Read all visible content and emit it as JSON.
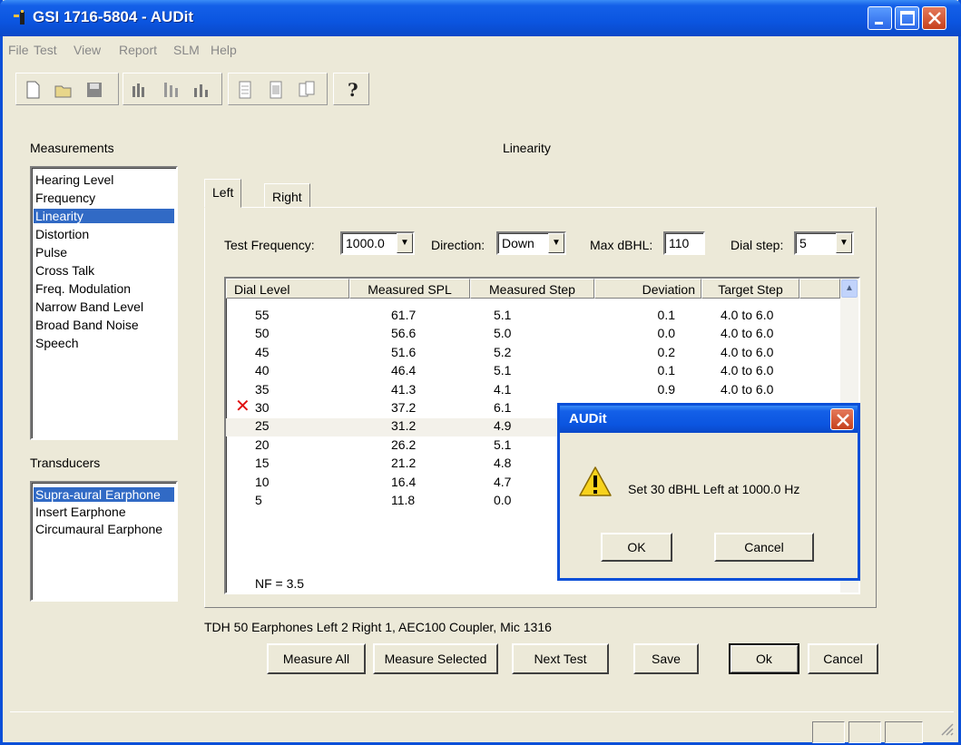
{
  "window": {
    "title": "GSI 1716-5804 - AUDit"
  },
  "menu": [
    "File",
    "Test",
    "View",
    "Report",
    "SLM",
    "Help"
  ],
  "toolbar_icons": [
    "new-icon",
    "open-icon",
    "save-icon",
    "audiogram-icon",
    "bars-icon",
    "bars-alt-icon",
    "report-icon",
    "report-list-icon",
    "report-compare-icon",
    "help-icon"
  ],
  "measurements": {
    "label": "Measurements",
    "items": [
      "Hearing Level",
      "Frequency",
      "Linearity",
      "Distortion",
      "Pulse",
      "Cross Talk",
      "Freq. Modulation",
      "Narrow Band Level",
      "Broad Band Noise",
      "Speech"
    ],
    "selected": "Linearity"
  },
  "transducers": {
    "label": "Transducers",
    "items": [
      "Supra-aural Earphone",
      "Insert Earphone",
      "Circumaural Earphone"
    ],
    "selected": "Supra-aural Earphone"
  },
  "section_title": "Linearity",
  "tabs": [
    "Left",
    "Right"
  ],
  "controls": {
    "test_frequency_label": "Test Frequency:",
    "test_frequency_value": "1000.0",
    "direction_label": "Direction:",
    "direction_value": "Down",
    "max_dbhl_label": "Max dBHL:",
    "max_dbhl_value": "110",
    "dial_step_label": "Dial step:",
    "dial_step_value": "5"
  },
  "table": {
    "headers": [
      "Dial Level",
      "Measured SPL",
      "Measured Step",
      "Deviation",
      "Target Step"
    ],
    "rows": [
      [
        "55",
        "61.7",
        "5.1",
        "0.1",
        "4.0 to 6.0"
      ],
      [
        "50",
        "56.6",
        "5.0",
        "0.0",
        "4.0 to 6.0"
      ],
      [
        "45",
        "51.6",
        "5.2",
        "0.2",
        "4.0 to 6.0"
      ],
      [
        "40",
        "46.4",
        "5.1",
        "0.1",
        "4.0 to 6.0"
      ],
      [
        "35",
        "41.3",
        "4.1",
        "0.9",
        "4.0 to 6.0"
      ],
      [
        "30",
        "37.2",
        "6.1",
        "",
        ""
      ],
      [
        "25",
        "31.2",
        "4.9",
        "",
        ""
      ],
      [
        "20",
        "26.2",
        "5.1",
        "",
        ""
      ],
      [
        "15",
        "21.2",
        "4.8",
        "",
        ""
      ],
      [
        "10",
        "16.4",
        "4.7",
        "",
        ""
      ],
      [
        "5",
        "11.8",
        "0.0",
        "",
        ""
      ]
    ],
    "footer": "NF = 3.5",
    "failed_marker": "✕"
  },
  "equipment_info": "TDH 50 Earphones Left 2 Right 1, AEC100 Coupler, Mic 1316",
  "buttons": {
    "measure_all": "Measure All",
    "measure_selected": "Measure Selected",
    "next_test": "Next Test",
    "save": "Save",
    "ok": "Ok",
    "cancel": "Cancel"
  },
  "dialog": {
    "title": "AUDit",
    "message": "Set 30 dBHL Left at 1000.0 Hz",
    "ok": "OK",
    "cancel": "Cancel"
  }
}
